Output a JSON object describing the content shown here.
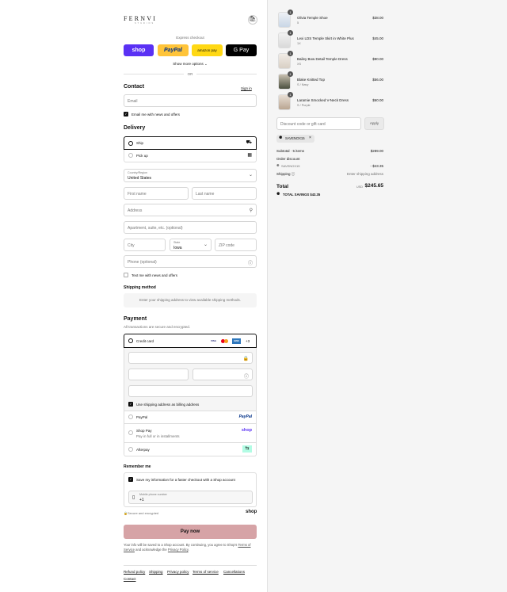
{
  "brand": {
    "logo_text": "FERNVI",
    "logo_sub": "STUDIOS"
  },
  "express": {
    "label": "Express checkout",
    "buttons": [
      {
        "label": "shop",
        "color": "#5a31f4"
      },
      {
        "label": "PayPal",
        "color": "#ffc439"
      },
      {
        "label": "amazon pay",
        "color": "#ffd814"
      },
      {
        "label": "G Pay",
        "color": "#000000"
      }
    ],
    "more": "Show more options",
    "or": "OR"
  },
  "contact": {
    "title": "Contact",
    "sign_in": "Sign in",
    "email_placeholder": "Email",
    "newsletter": "Email me with news and offers"
  },
  "delivery": {
    "title": "Delivery",
    "ship": "Ship",
    "pickup": "Pick up",
    "country_label": "Country/Region",
    "country": "United States",
    "first_name": "First name",
    "last_name": "Last name",
    "address": "Address",
    "apartment": "Apartment, suite, etc. (optional)",
    "city": "City",
    "state_label": "State",
    "state": "Iowa",
    "zip": "ZIP code",
    "phone": "Phone (optional)",
    "text_me": "Text me with news and offers"
  },
  "shipping_method": {
    "title": "Shipping method",
    "notice": "Enter your shipping address to view available shipping methods."
  },
  "payment": {
    "title": "Payment",
    "subtitle": "All transactions are secure and encrypted.",
    "credit_card": "Credit card",
    "cards": [
      "VISA",
      "MC",
      "AMEX"
    ],
    "more_cards": "+3",
    "billing_same": "Use shipping address as billing address",
    "paypal": "PayPal",
    "paypal_logo": "PayPal",
    "shop_pay": "Shop Pay",
    "shop_pay_sub": "Pay in full or in installments",
    "shop_pay_logo": "shop",
    "afterpay": "Afterpay"
  },
  "remember": {
    "title": "Remember me",
    "save_info": "Save my information for a faster checkout with a Shop account",
    "mobile_label": "Mobile phone number",
    "mobile_value": "+1",
    "secure": "Secure and encrypted",
    "shop_logo": "shop"
  },
  "pay_now": {
    "label": "Pay now",
    "color": "#d6a3a6"
  },
  "legal": {
    "line1": "Your info will be saved to a Shop account. By continuing, you agree to Shop's",
    "terms": "Terms of Service",
    "and": "and acknowledge the",
    "privacy": "Privacy Policy"
  },
  "footer_links": [
    "Refund policy",
    "Shipping",
    "Privacy policy",
    "Terms of service",
    "Cancellations",
    "Contact"
  ],
  "cart": {
    "items": [
      {
        "name": "Olivia Temple Shoe",
        "variant": "5",
        "price": "$38.00",
        "qty": "1"
      },
      {
        "name": "Lexi LDS Temple Skirt in White Plus",
        "variant": "1X",
        "price": "$45.00",
        "qty": "1"
      },
      {
        "name": "Bailey Bow Detail Temple Dress",
        "variant": "XS",
        "price": "$90.00",
        "qty": "1"
      },
      {
        "name": "Blake Knitted Top",
        "variant": "S / Navy",
        "price": "$56.00",
        "qty": "1"
      },
      {
        "name": "Laramie Smocked V-Neck Dress",
        "variant": "S / Purple",
        "price": "$60.00",
        "qty": "1"
      }
    ],
    "discount_placeholder": "Discount code or gift card",
    "apply": "Apply",
    "code": "SAVENOX15",
    "subtotal_label": "Subtotal · 5 items",
    "subtotal": "$289.00",
    "order_discount_label": "Order discount",
    "discount_code": "SAVENOX15",
    "discount_value": "- $43.35",
    "shipping_label": "Shipping",
    "shipping_value": "Enter shipping address",
    "total_label": "Total",
    "currency": "USD",
    "total": "$245.65",
    "savings_label": "TOTAL SAVINGS",
    "savings": "$43.35"
  }
}
